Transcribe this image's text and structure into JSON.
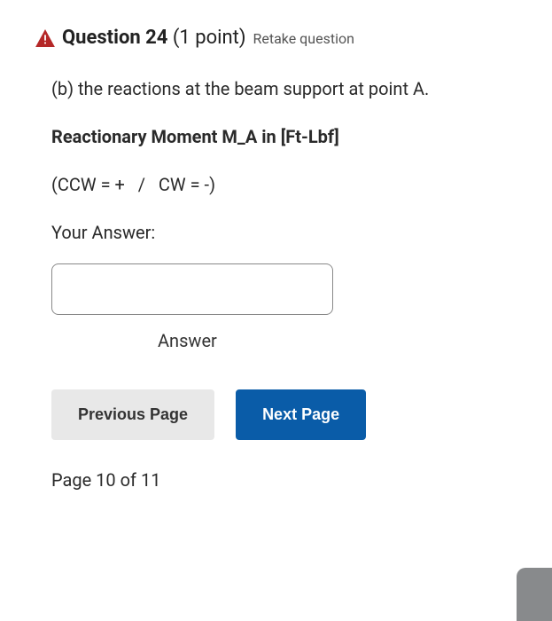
{
  "header": {
    "question_prefix": "Question",
    "question_number": "24",
    "points_text": "(1 point)",
    "retake_label": "Retake question",
    "icon_name": "warning"
  },
  "body": {
    "part_b": "(b) the reactions at the beam support at point A.",
    "reaction_moment_label": "Reactionary Moment M_A in [Ft-Lbf]",
    "sign_convention": "(CCW = +   /   CW = -)",
    "your_answer_label": "Your Answer:",
    "answer_value": "",
    "answer_field_label": "Answer"
  },
  "nav": {
    "prev_label": "Previous Page",
    "next_label": "Next Page"
  },
  "footer": {
    "page_counter": "Page 10 of 11"
  }
}
